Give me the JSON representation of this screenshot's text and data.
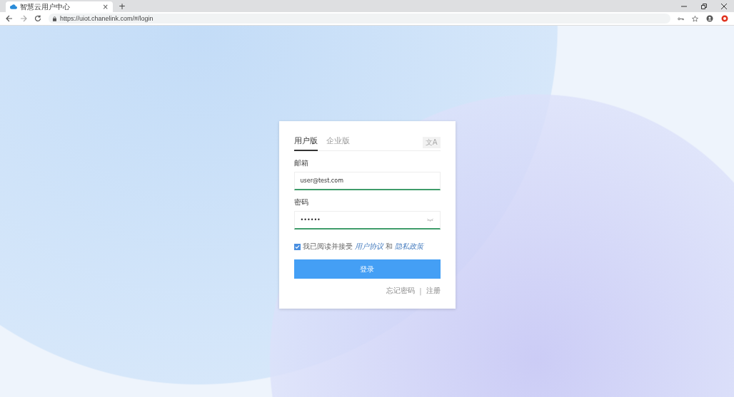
{
  "browser": {
    "tab": {
      "title": "智慧云用户中心",
      "close": "×"
    },
    "new_tab": "+",
    "url": "https://uiot.chanelink.com/#/login"
  },
  "login": {
    "tabs": [
      {
        "label": "用户版",
        "selected": true
      },
      {
        "label": "企业版",
        "selected": false
      }
    ],
    "fields": [
      {
        "label": "邮箱",
        "value": "user@test.com",
        "kind": "text"
      },
      {
        "label": "密码",
        "value": "••••••",
        "kind": "password"
      }
    ],
    "agreement": {
      "checked": true,
      "text": "我已阅读并接受",
      "link_1": "用户协议",
      "joiner": "和",
      "link_2": "隐私政策"
    },
    "language": "文A",
    "submit": "登录",
    "forgot": "忘记密码",
    "separator": "|",
    "register": "注册"
  }
}
